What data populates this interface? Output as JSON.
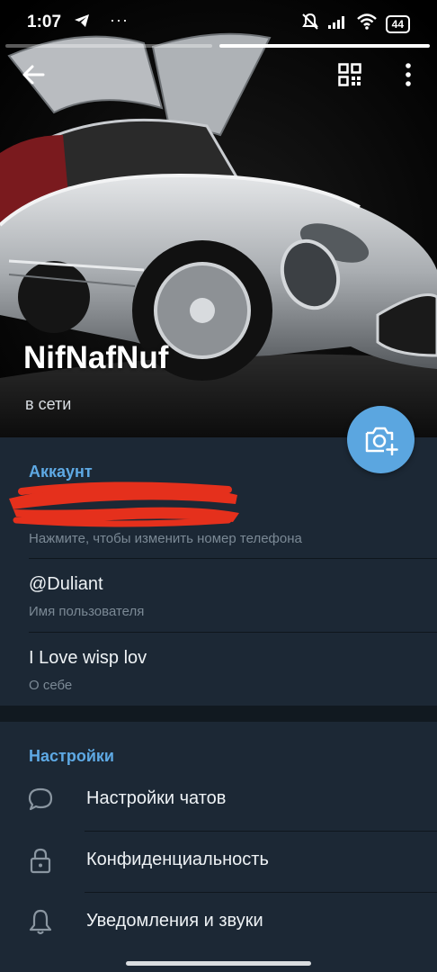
{
  "status_bar": {
    "time": "1:07",
    "extra": "···",
    "battery": "44"
  },
  "header": {
    "back_icon": "arrow-left-icon",
    "qr_icon": "qr-code-icon",
    "menu_icon": "more-vertical-icon",
    "camera_icon": "camera-add-icon"
  },
  "profile": {
    "name": "NifNafNuf",
    "status": "в сети"
  },
  "account": {
    "section_title": "Аккаунт",
    "phone_hint": "Нажмите, чтобы изменить номер телефона",
    "username": "@Duliant",
    "username_hint": "Имя пользователя",
    "bio": "I Love wisp lov",
    "bio_hint": "О себе"
  },
  "settings": {
    "section_title": "Настройки",
    "items": [
      {
        "label": "Настройки чатов",
        "icon": "chat-bubble-icon"
      },
      {
        "label": "Конфиденциальность",
        "icon": "lock-icon"
      },
      {
        "label": "Уведомления и звуки",
        "icon": "bell-icon"
      }
    ]
  },
  "colors": {
    "accent": "#5ea9e4",
    "fab": "#5ba6e0",
    "background": "#17212b",
    "section": "#1c2835",
    "redaction": "#e5301c"
  }
}
